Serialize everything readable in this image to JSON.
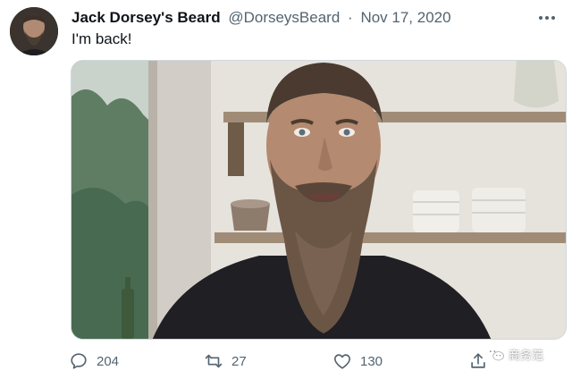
{
  "tweet": {
    "author_name": "Jack Dorsey's Beard",
    "handle": "@DorseysBeard",
    "separator": "·",
    "date": "Nov 17, 2020",
    "text": "I'm back!"
  },
  "actions": {
    "reply_count": "204",
    "retweet_count": "27",
    "like_count": "130"
  },
  "watermark": {
    "text": "商务范"
  },
  "icons": {
    "more": "more-icon",
    "reply": "reply-icon",
    "retweet": "retweet-icon",
    "like": "heart-icon",
    "share": "share-icon",
    "watermark": "wechat-icon"
  },
  "colors": {
    "text_primary": "#0f1419",
    "text_secondary": "#536471",
    "border": "#cfd9de"
  }
}
